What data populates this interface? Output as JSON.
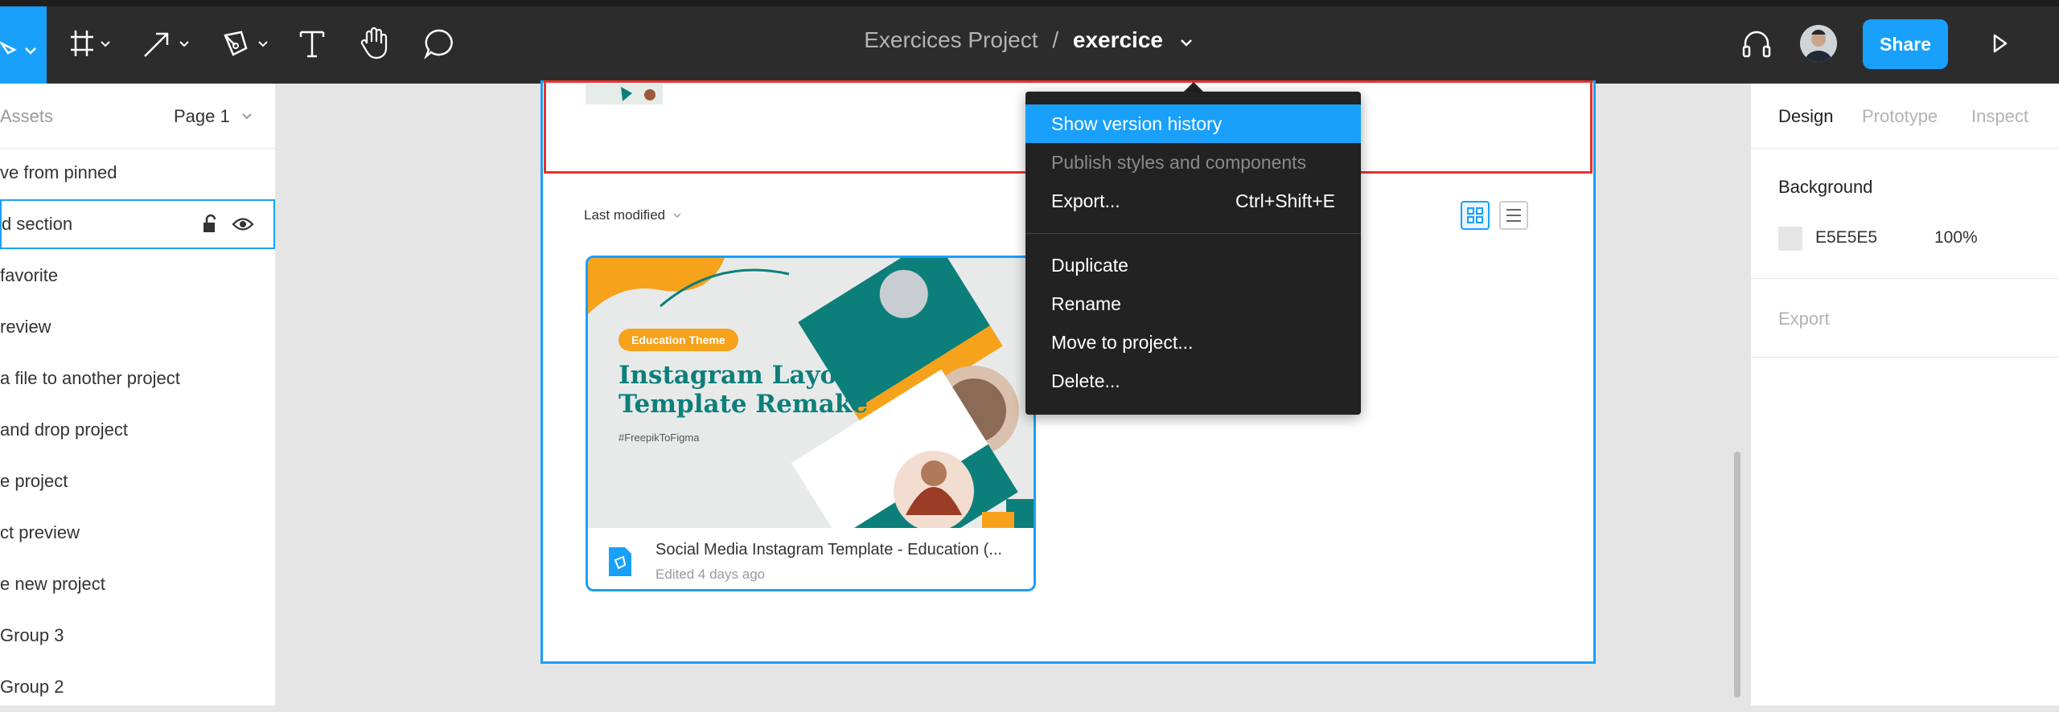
{
  "header": {
    "project": "Exercices Project",
    "separator": "/",
    "file": "exercice",
    "share_label": "Share"
  },
  "layers_panel": {
    "assets_label": "Assets",
    "page_label": "Page 1",
    "items": [
      {
        "label": "ve from pinned"
      },
      {
        "label": "d section"
      },
      {
        "label": " favorite"
      },
      {
        "label": "review"
      },
      {
        "label": " a file to another project"
      },
      {
        "label": "and drop project"
      },
      {
        "label": "e project"
      },
      {
        "label": "ct preview"
      },
      {
        "label": "e new project"
      },
      {
        "label": "Group 3"
      },
      {
        "label": "Group 2"
      }
    ]
  },
  "canvas": {
    "sort_label": "Last modified",
    "card": {
      "title": "Social Media Instagram Template - Education (...",
      "subtitle": "Edited 4 days ago",
      "thumb": {
        "pill": "Education Theme",
        "heading_line1": "Instagram Layout",
        "heading_line2": "Template Remake",
        "tag": "#FreepikToFigma"
      }
    }
  },
  "menu": {
    "items": [
      {
        "label": "Show version history",
        "shortcut": ""
      },
      {
        "label": "Publish styles and components",
        "shortcut": ""
      },
      {
        "label": "Export...",
        "shortcut": "Ctrl+Shift+E"
      },
      {
        "label": "Duplicate",
        "shortcut": ""
      },
      {
        "label": "Rename",
        "shortcut": ""
      },
      {
        "label": "Move to project...",
        "shortcut": ""
      },
      {
        "label": "Delete...",
        "shortcut": ""
      }
    ]
  },
  "right_panel": {
    "tabs": [
      "Design",
      "Prototype",
      "Inspect"
    ],
    "background_title": "Background",
    "bg_hex": "E5E5E5",
    "bg_opacity": "100%",
    "export_title": "Export"
  },
  "colors": {
    "accent": "#18a0fb",
    "toolbar": "#2c2c2c",
    "menu": "#222222",
    "selection_red": "#e8322e",
    "canvas_bg": "#e5e5e5"
  }
}
